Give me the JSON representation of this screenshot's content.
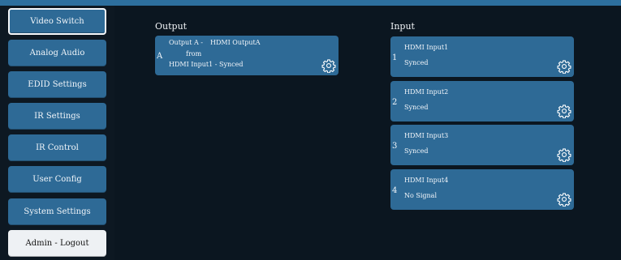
{
  "sidebar": {
    "items": [
      {
        "label": "Video Switch"
      },
      {
        "label": "Analog Audio"
      },
      {
        "label": "EDID Settings"
      },
      {
        "label": "IR Settings"
      },
      {
        "label": "IR Control"
      },
      {
        "label": "User Config"
      },
      {
        "label": "System Settings"
      },
      {
        "label": "Admin - Logout"
      }
    ]
  },
  "output": {
    "title": "Output",
    "card": {
      "index": "A",
      "line1_name": "Output A -",
      "line1_label": "HDMI OutputA",
      "line2": "from",
      "line3": "HDMI Input1 - Synced"
    }
  },
  "input": {
    "title": "Input",
    "cards": [
      {
        "index": "1",
        "name": "HDMI Input1",
        "status": "Synced"
      },
      {
        "index": "2",
        "name": "HDMI Input2",
        "status": "Synced"
      },
      {
        "index": "3",
        "name": "HDMI Input3",
        "status": "Synced"
      },
      {
        "index": "4",
        "name": "HDMI Input4",
        "status": "No Signal"
      }
    ]
  },
  "colors": {
    "background": "#0c1721",
    "accent": "#2e6a96",
    "top_bar": "#2d6f9e",
    "logout_button": "#eef1f4"
  },
  "icons": {
    "settings": "gear-icon"
  }
}
